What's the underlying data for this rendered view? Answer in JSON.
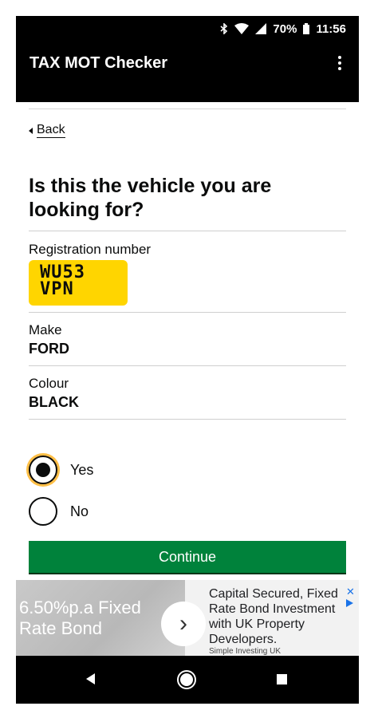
{
  "status_bar": {
    "battery": "70%",
    "time": "11:56"
  },
  "app_bar": {
    "title": "TAX MOT Checker"
  },
  "page": {
    "back_label": "Back",
    "heading": "Is this the vehicle you are looking for?",
    "registration": {
      "label": "Registration number",
      "plate_line1": "WU53",
      "plate_line2": "VPN"
    },
    "make": {
      "label": "Make",
      "value": "FORD"
    },
    "colour": {
      "label": "Colour",
      "value": "BLACK"
    },
    "options": [
      {
        "label": "Yes",
        "selected": true
      },
      {
        "label": "No",
        "selected": false
      }
    ],
    "continue_label": "Continue"
  },
  "ad": {
    "left_text_line1": "6.50%p.a Fixed",
    "left_text_line2": "Rate Bond",
    "body": "Capital Secured, Fixed Rate Bond Investment with UK Property Developers.",
    "advertiser": "Simple Investing UK"
  },
  "colors": {
    "plate": "#ffd500",
    "button": "#00823b",
    "focus": "#ffbf47"
  }
}
